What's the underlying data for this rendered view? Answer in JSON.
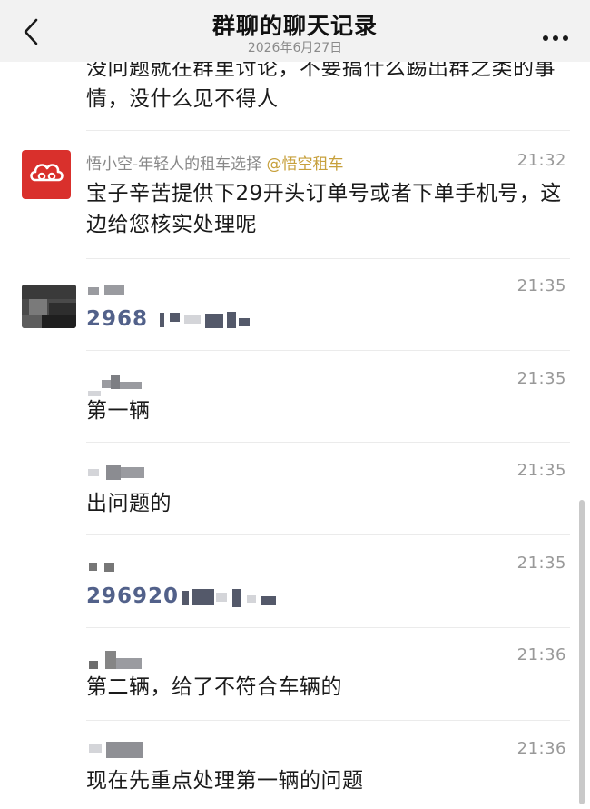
{
  "header": {
    "title": "群聊的聊天记录",
    "date": "2026年6月27日"
  },
  "continuation": {
    "text": "没问题就在群里讨论，不要搞什么踢出群之类的事情，没什么见不得人"
  },
  "messages": [
    {
      "sender": "悟小空-年轻人的租车选择",
      "mention": "@悟空租车",
      "time": "21:32",
      "text": "宝子辛苦提供下29开头订单号或者下单手机号，这边给您核实处理呢"
    },
    {
      "time": "21:35",
      "text": "2968"
    },
    {
      "time": "21:35",
      "text": "第一辆"
    },
    {
      "time": "21:35",
      "text": "出问题的"
    },
    {
      "time": "21:35",
      "text": "296920"
    },
    {
      "time": "21:36",
      "text": "第二辆，给了不符合车辆的"
    },
    {
      "time": "21:36",
      "text": "现在先重点处理第一辆的问题"
    }
  ],
  "icons": {
    "back": "chevron-left-icon",
    "more": "more-icon",
    "avatar_logo": "cloud-logo-icon"
  },
  "colors": {
    "brand_red": "#d9302c",
    "mention": "#c7a03c",
    "number_text": "#52618a"
  }
}
